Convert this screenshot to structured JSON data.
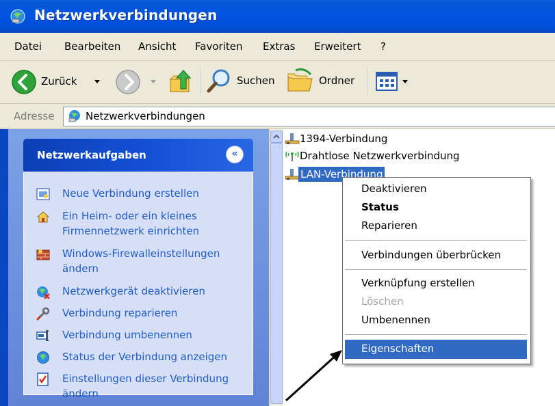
{
  "window": {
    "title": "Netzwerkverbindungen",
    "title_icon": "network-connections-icon"
  },
  "menubar": {
    "items": [
      "Datei",
      "Bearbeiten",
      "Ansicht",
      "Favoriten",
      "Extras",
      "Erweitert",
      "?"
    ]
  },
  "toolbar": {
    "back_label": "Zurück",
    "search_label": "Suchen",
    "folders_label": "Ordner",
    "icons": [
      "back-arrow-icon",
      "forward-arrow-icon",
      "up-folder-icon",
      "search-magnifier-icon",
      "folders-icon",
      "views-icon"
    ]
  },
  "address": {
    "label": "Adresse",
    "value": "Netzwerkverbindungen"
  },
  "taskpane": {
    "title": "Netzwerkaufgaben",
    "tasks": [
      {
        "line1": "Neue Verbindung erstellen",
        "line2": ""
      },
      {
        "line1": "Ein Heim- oder ein kleines",
        "line2": "Firmennetzwerk einrichten"
      },
      {
        "line1": "Windows-Firewalleinstellungen",
        "line2": "ändern"
      },
      {
        "line1": "Netzwerkgerät deaktivieren",
        "line2": ""
      },
      {
        "line1": "Verbindung reparieren",
        "line2": ""
      },
      {
        "line1": "Verbindung umbenennen",
        "line2": ""
      },
      {
        "line1": "Status der Verbindung anzeigen",
        "line2": ""
      },
      {
        "line1": "Einstellungen dieser Verbindung",
        "line2": "ändern"
      }
    ]
  },
  "connections": [
    {
      "label": "1394-Verbindung",
      "selected": false
    },
    {
      "label": "Drahtlose Netzwerkverbindung",
      "selected": false
    },
    {
      "label": "LAN-Verbindung",
      "selected": true
    }
  ],
  "context_menu": {
    "items": [
      {
        "label": "Deaktivieren",
        "state": "normal"
      },
      {
        "label": "Status",
        "state": "default"
      },
      {
        "label": "Reparieren",
        "state": "normal"
      },
      {
        "label": "Verbindungen überbrücken",
        "state": "normal"
      },
      {
        "label": "Verknüpfung erstellen",
        "state": "normal"
      },
      {
        "label": "Löschen",
        "state": "disabled"
      },
      {
        "label": "Umbenennen",
        "state": "normal"
      },
      {
        "label": "Eigenschaften",
        "state": "highlighted"
      }
    ]
  },
  "colors": {
    "titlebar": "#0054e3",
    "selection": "#316ac5",
    "task_link": "#215dc6",
    "chrome": "#ece9d8"
  }
}
